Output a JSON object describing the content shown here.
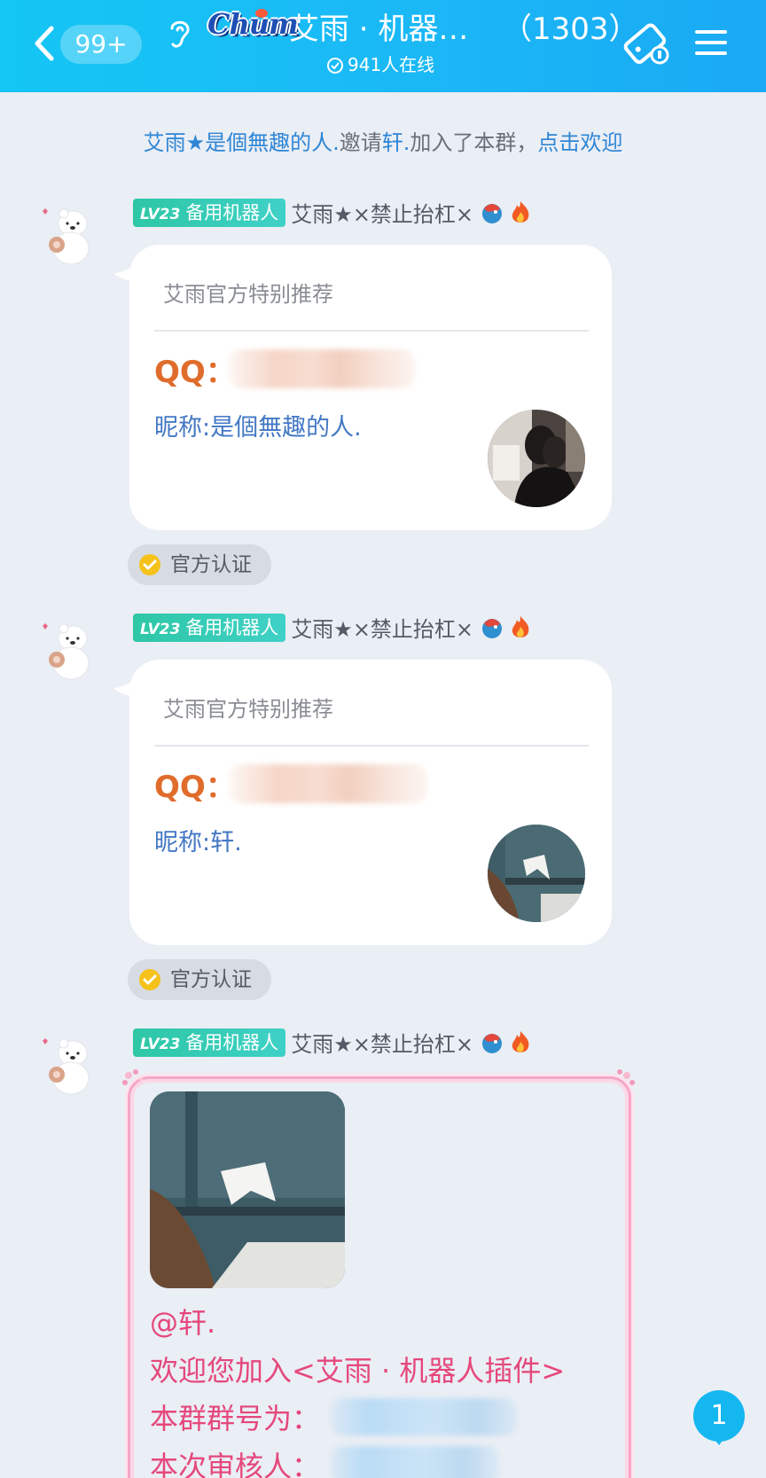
{
  "header": {
    "unread_count": "99+",
    "logo_text": "Chum",
    "group_name": "艾雨 · 机器…",
    "member_count": "（1303）",
    "online_text": "941人在线",
    "accent": "#1bb8f6"
  },
  "system_notice": {
    "inviter": "艾雨★是個無趣的人.",
    "verb": "邀请",
    "invitee": "轩.",
    "suffix": "加入了本群，",
    "action": "点击欢迎"
  },
  "messages": [
    {
      "level": "LV23",
      "title": "备用机器人",
      "sender": "艾雨★×禁止抬杠×",
      "card": {
        "title": "艾雨官方特别推荐",
        "qq_label": "QQ：",
        "nickname": "昵称:是個無趣的人."
      },
      "badge": "官方认证"
    },
    {
      "level": "LV23",
      "title": "备用机器人",
      "sender": "艾雨★×禁止抬杠×",
      "card": {
        "title": "艾雨官方特别推荐",
        "qq_label": "QQ：",
        "nickname": "昵称:轩."
      },
      "badge": "官方认证"
    },
    {
      "level": "LV23",
      "title": "备用机器人",
      "sender": "艾雨★×禁止抬杠×",
      "lines": [
        "@轩.",
        "欢迎您加入<艾雨 · 机器人插件>",
        "本群群号为：",
        "本次审核人："
      ]
    }
  ],
  "new_message_count": "1",
  "colors": {
    "background": "#eaeef5",
    "qq_orange": "#e06c2c",
    "nickname_blue": "#4378c4",
    "level_green": "#2ec7a6",
    "welcome_pink": "#e5487b",
    "link_blue": "#2f86d6"
  }
}
